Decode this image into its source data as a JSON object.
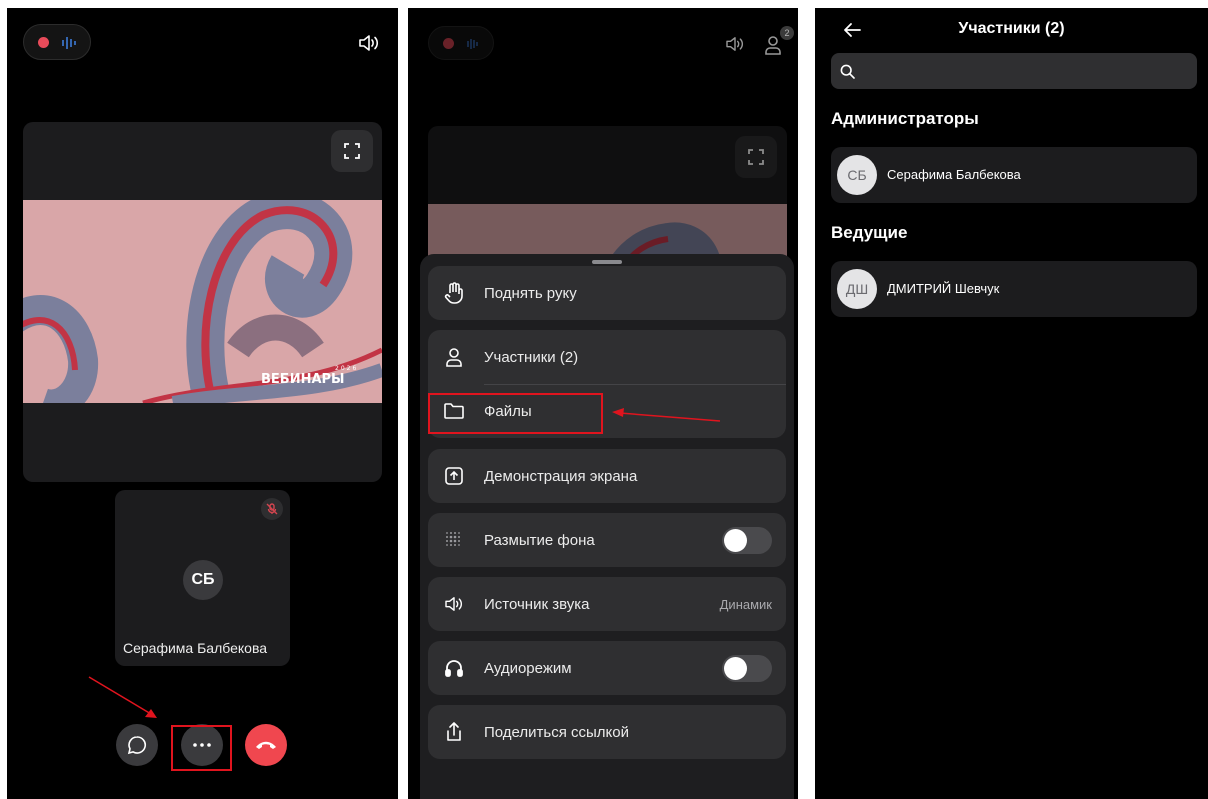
{
  "call_screen": {
    "tile": {
      "initials": "СБ",
      "name": "Серафима Балбекова"
    },
    "slide": {
      "brand": "ВЕБИНАРЫ",
      "year": "2026"
    },
    "icons": [
      "record-icon",
      "waveform-icon",
      "speaker-icon",
      "fullscreen-icon",
      "mic-off-icon",
      "chat-icon",
      "more-icon",
      "hangup-icon"
    ]
  },
  "menu_screen": {
    "participants_badge": "2",
    "items": [
      {
        "label": "Поднять руку",
        "icon": "hand-icon"
      },
      {
        "label": "Участники (2)",
        "icon": "user-icon"
      },
      {
        "label": "Файлы",
        "icon": "folder-icon"
      },
      {
        "label": "Демонстрация экрана",
        "icon": "screen-share-icon"
      },
      {
        "label": "Размытие фона",
        "icon": "blur-icon",
        "toggle": false
      },
      {
        "label": "Источник звука",
        "icon": "speaker-icon",
        "value": "Динамик"
      },
      {
        "label": "Аудиорежим",
        "icon": "headphones-icon",
        "toggle": false
      },
      {
        "label": "Поделиться ссылкой",
        "icon": "share-icon"
      }
    ]
  },
  "participants_screen": {
    "title": "Участники (2)",
    "search_placeholder": "",
    "sections": [
      {
        "heading": "Администраторы",
        "people": [
          {
            "initials": "СБ",
            "name": "Серафима Балбекова"
          }
        ]
      },
      {
        "heading": "Ведущие",
        "people": [
          {
            "initials": "ДШ",
            "name": "ДМИТРИЙ Шевчук"
          }
        ]
      }
    ]
  },
  "colors": {
    "accent_red": "#e84b5a",
    "annotation_red": "#e0141e",
    "hangup": "#f0474f",
    "card": "#1c1c1e"
  }
}
